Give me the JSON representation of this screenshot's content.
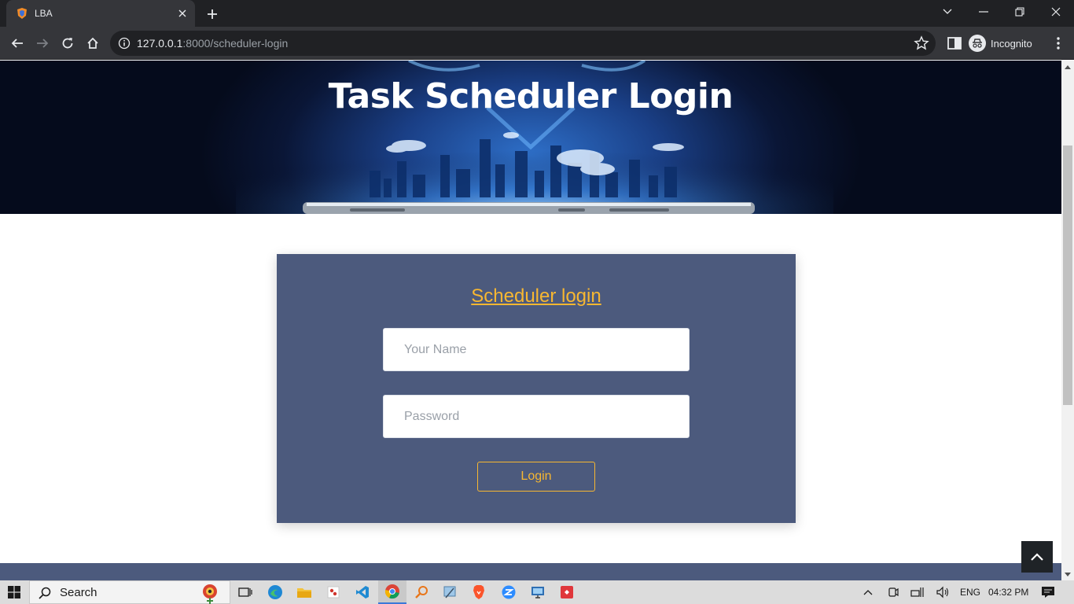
{
  "browser": {
    "tab_title": "LBA",
    "url_host": "127.0.0.1",
    "url_rest": ":8000/scheduler-login",
    "profile_label": "Incognito"
  },
  "page": {
    "hero_title": "Task Scheduler Login",
    "card_title": "Scheduler login",
    "name_field": {
      "placeholder": "Your Name",
      "value": ""
    },
    "password_field": {
      "placeholder": "Password",
      "value": ""
    },
    "login_button": "Login"
  },
  "colors": {
    "card_bg": "#4c5a7d",
    "accent": "#f7b731",
    "hero_bg": "#0a1636"
  },
  "taskbar": {
    "search_label": "Search",
    "apps": [
      "task-view-icon",
      "edge-icon",
      "file-explorer-icon",
      "photos-icon",
      "vscode-icon",
      "chrome-icon",
      "search-tool-icon",
      "snipping-icon",
      "brave-icon",
      "zoom-icon",
      "remote-desktop-icon",
      "anydesk-icon"
    ],
    "language": "ENG",
    "time": "04:32 PM"
  }
}
